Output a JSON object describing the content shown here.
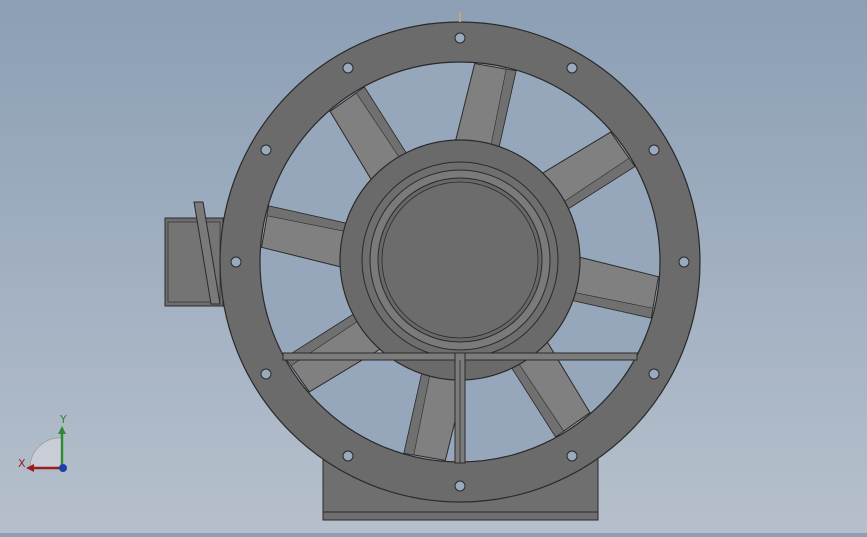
{
  "viewport": {
    "model": "axial-fan",
    "colors": {
      "background_top": "#8c9fb5",
      "background_bottom": "#b6c0cc",
      "flange": "#6b6b6b",
      "flange_dark": "#5a5a5a",
      "blade": "#808080",
      "blade_dark": "#707070",
      "hub": "#6a6a6a",
      "edge": "#2a2a2a"
    },
    "blade_count": 8,
    "bolt_hole_count": 12
  },
  "triad": {
    "x_label": "X",
    "y_label": "Y",
    "x_color": "#9b1c1c",
    "y_color": "#2e8b2e",
    "z_color": "#1f3fa8"
  }
}
